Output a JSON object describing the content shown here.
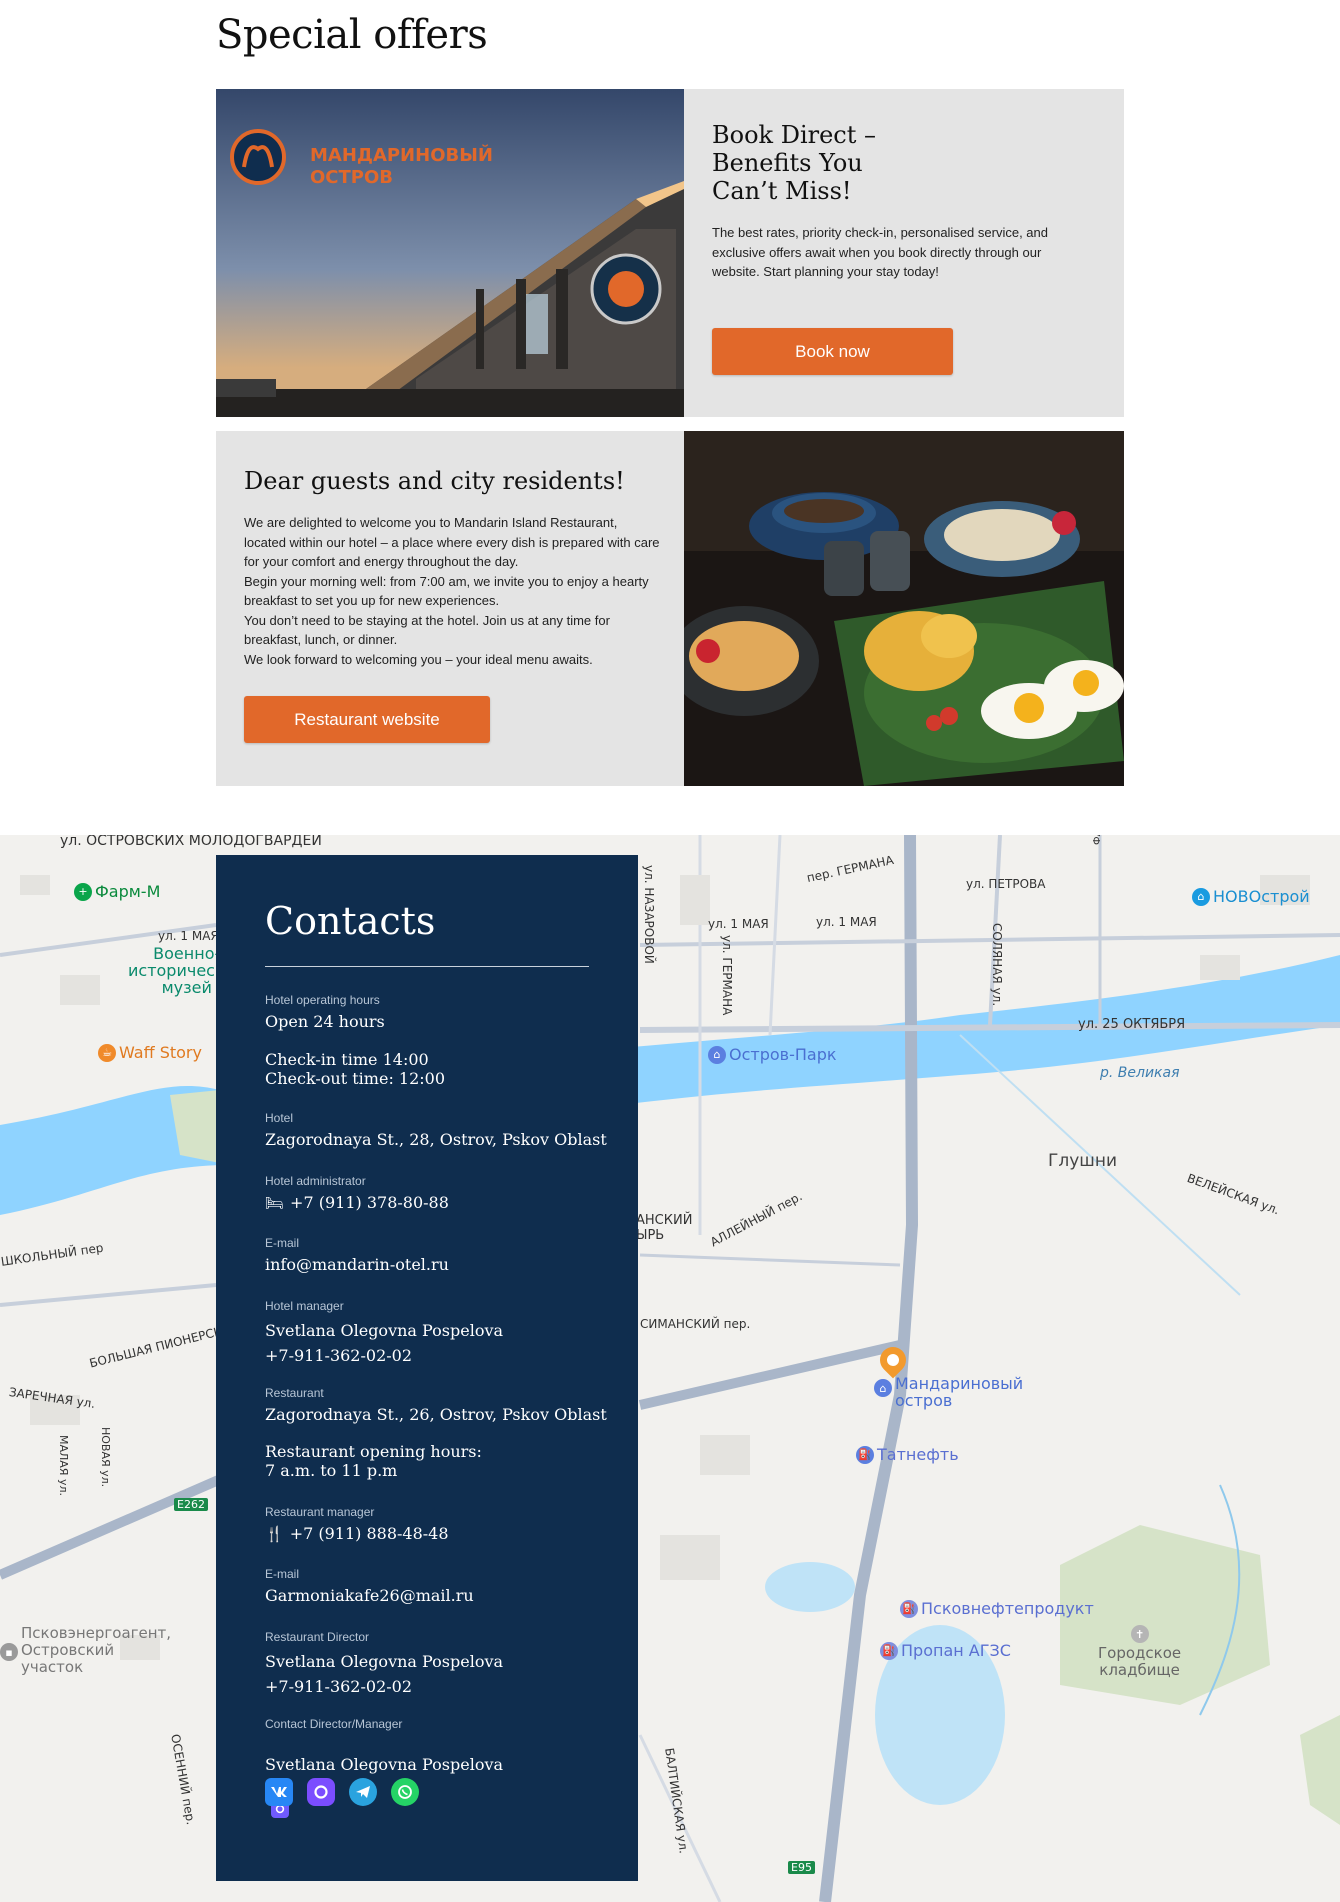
{
  "offers": {
    "title": "Special offers",
    "card1": {
      "heading": "Book Direct – Benefits You Can’t Miss!",
      "text": "The best rates, priority check-in, personalised service, and exclusive offers await when you book directly through our website. Start planning your stay today!",
      "button": "Book now",
      "image_logo_text_line1": "МАНДАРИНОВЫЙ",
      "image_logo_text_line2": "ОСТРОВ"
    },
    "card2": {
      "heading": "Dear guests and city residents!",
      "text": "We are delighted to welcome you to Mandarin Island Restaurant, located within our hotel – a place where every dish is prepared with care for your comfort and energy throughout the day.\nBegin your morning well: from 7:00 am, we invite you to enjoy a hearty breakfast to set you up for new experiences.\nYou don’t need to be staying at the hotel. Join us at any time for breakfast, lunch, or dinner.\nWe look forward to welcoming you – your ideal menu awaits.",
      "button": "Restaurant website"
    }
  },
  "contacts": {
    "title": "Contacts",
    "hotel_hours_label": "Hotel operating hours",
    "hotel_hours": "Open 24 hours",
    "check_times": "Check-in time 14:00\nCheck-out time: 12:00",
    "hotel_label": "Hotel",
    "hotel_address": "Zagorodnaya St., 28, Ostrov, Pskov Oblast",
    "admin_label": "Hotel administrator",
    "admin_phone": "+7 (911) 378-80-88",
    "email_label": "E-mail",
    "hotel_email": "info@mandarin-otel.ru",
    "manager_label": "Hotel manager",
    "manager": "Svetlana Olegovna Pospelova\n+7-911-362-02-02",
    "restaurant_label": "Restaurant",
    "restaurant_address": "Zagorodnaya St., 26, Ostrov, Pskov Oblast",
    "restaurant_hours": "Restaurant opening hours:\n7 a.m. to 11 p.m",
    "rest_manager_label": "Restaurant manager",
    "rest_manager_phone": "+7 (911) 888-48-48",
    "email2_label": "E-mail",
    "rest_email": "Garmoniakafe26@mail.ru",
    "director_label": "Restaurant Director",
    "director": "Svetlana Olegovna Pospelova\n+7-911-362-02-02",
    "contact_label": "Contact Director/Manager",
    "contact_name": "Svetlana Olegovna Pospelova"
  },
  "map": {
    "labels": {
      "ostrovskikh": "ул. ОСТРОВСКИХ МОЛОДОГВАРДЕЙ",
      "farm": "Фарм-М",
      "may1a": "ул. 1 МАЯ",
      "museum": "Военно-\nисторический\nмузей",
      "waff": "Waff Story",
      "nazarovoy": "ул. НАЗАРОВОЙ",
      "germana_lane": "пер. ГЕРМАНА",
      "may1b": "ул. 1 МАЯ",
      "may1c": "ул. 1 МАЯ",
      "germana_st": "ул. ГЕРМАНА",
      "petrova": "ул. ПЕТРОВА",
      "fabrichnaya": "ФАБРИЧНАЯ ул.",
      "novostroy": "НОВОстрой",
      "solyanaya": "СОЛЯНАЯ ул.",
      "oktyabrya": "ул. 25 ОКТЯБРЯ",
      "ostrov_park": "Остров-Парк",
      "velikaya": "р. Великая",
      "glushni": "Глушни",
      "veleyskaya": "ВЕЛЕЙСКАЯ ул.",
      "alleyny": "АЛЛЕЙНЫЙ пер.",
      "shkolny": "ШКОЛЬНЫЙ пер",
      "pionerskaya": "БОЛЬШАЯ ПИОНЕРСКАЯ",
      "zarechnaya": "ЗАРЕЧНАЯ ул.",
      "malaya": "МАЛАЯ ул.",
      "novaya": "НОВАЯ ул.",
      "e262": "E262",
      "mandarin": "Мандариновый\nостров",
      "tatneft": "Татнефть",
      "pskovneft": "Псковнефтепродукт",
      "propan": "Пропан АГЗС",
      "cemetery": "Городское\nкладбище",
      "energo": "Псковэнергоагент,\nОстровский\nучасток",
      "osenny": "ОСЕННИЙ пер.",
      "baltiyskaya": "БАЛТИЙСКАЯ ул.",
      "e95": "E95",
      "simansky": "СИМАНСКИЙ пер.",
      "anskiy": "АНСКИЙ\nЫРЬ"
    }
  }
}
